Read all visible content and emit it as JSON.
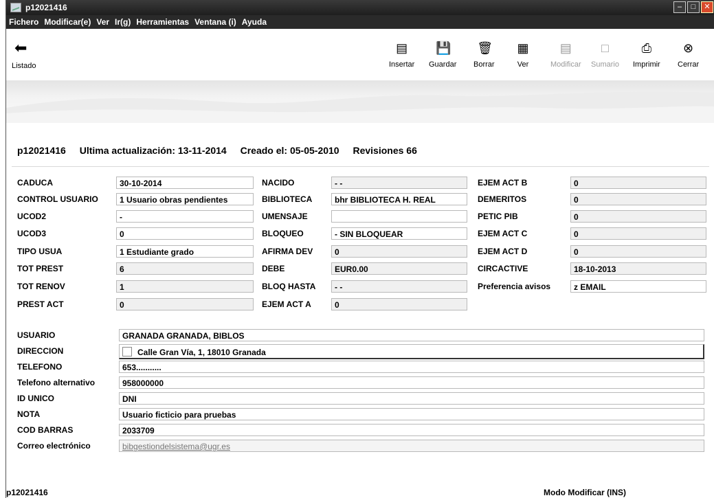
{
  "window": {
    "title": "p12021416"
  },
  "menu": [
    "Fichero",
    "Modificar(e)",
    "Ver",
    "Ir(g)",
    "Herramientas",
    "Ventana (i)",
    "Ayuda"
  ],
  "toolbar": {
    "listado": "Listado",
    "insertar": "Insertar",
    "guardar": "Guardar",
    "borrar": "Borrar",
    "ver": "Ver",
    "modificar": "Modificar",
    "sumario": "Sumario",
    "imprimir": "Imprimir",
    "cerrar": "Cerrar"
  },
  "header": {
    "record_id": "p12021416",
    "updated": "Ultima actualización: 13-11-2014",
    "created": "Creado el: 05-05-2010",
    "revisions": "Revisiones 66"
  },
  "col1": [
    {
      "label": "CADUCA",
      "value": "30-10-2014"
    },
    {
      "label": "CONTROL USUARIO",
      "value": "1  Usuario obras pendientes"
    },
    {
      "label": "UCOD2",
      "value": "-"
    },
    {
      "label": "UCOD3",
      "value": "0"
    },
    {
      "label": "TIPO USUA",
      "value": "1  Estudiante grado"
    },
    {
      "label": "TOT PREST",
      "value": "6"
    },
    {
      "label": "TOT RENOV",
      "value": "1"
    },
    {
      "label": "PREST ACT",
      "value": "0"
    }
  ],
  "col2": [
    {
      "label": "NACIDO",
      "value": "- -"
    },
    {
      "label": "BIBLIOTECA",
      "value": "bhr   BIBLIOTECA H. REAL"
    },
    {
      "label": "UMENSAJE",
      "value": ""
    },
    {
      "label": "BLOQUEO",
      "value": "-  SIN BLOQUEAR"
    },
    {
      "label": "AFIRMA DEV",
      "value": "0"
    },
    {
      "label": "DEBE",
      "value": "EUR0.00"
    },
    {
      "label": "BLOQ HASTA",
      "value": "- -"
    },
    {
      "label": "EJEM ACT A",
      "value": "0"
    }
  ],
  "col3": [
    {
      "label": "EJEM ACT B",
      "value": "0"
    },
    {
      "label": "DEMERITOS",
      "value": "0"
    },
    {
      "label": "PETIC PIB",
      "value": "0"
    },
    {
      "label": "EJEM ACT C",
      "value": "0"
    },
    {
      "label": "EJEM ACT D",
      "value": "0"
    },
    {
      "label": "CIRCACTIVE",
      "value": "18-10-2013"
    },
    {
      "label": "Preferencia avisos",
      "value": "z  EMAIL"
    }
  ],
  "details": {
    "usuario": {
      "label": "USUARIO",
      "value": "GRANADA GRANADA, BIBLOS"
    },
    "direccion": {
      "label": "DIRECCION",
      "value": "Calle Gran Vía, 1, 18010 Granada"
    },
    "telefono": {
      "label": "TELEFONO",
      "value": "653..........."
    },
    "telefono_alt": {
      "label": "Telefono alternativo",
      "value": "958000000"
    },
    "id_unico": {
      "label": "ID UNICO",
      "value": "DNI"
    },
    "nota": {
      "label": "NOTA",
      "value": "Usuario ficticio para pruebas"
    },
    "cod_barras": {
      "label": "COD BARRAS",
      "value": "2033709"
    },
    "correo": {
      "label": "Correo electrónico",
      "value": "bibgestiondelsistema@ugr.es"
    }
  },
  "status": {
    "left": "p12021416",
    "right": "Modo Modificar (INS)"
  }
}
